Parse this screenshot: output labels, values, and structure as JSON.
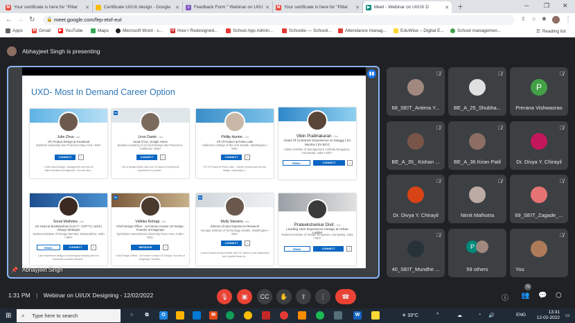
{
  "browser": {
    "tabs": [
      {
        "label": "Your certificate is here for \"Pillar",
        "color": "#ea4335",
        "icon": "gmail-icon",
        "glyph": "M"
      },
      {
        "label": "Certificate UI/UX design - Google",
        "color": "#fbbc04",
        "icon": "slides-icon",
        "glyph": ""
      },
      {
        "label": "Feedback Form \" Webinar on UI/U",
        "color": "#7e57c2",
        "icon": "forms-icon",
        "glyph": "≡"
      },
      {
        "label": "Your certificate is here for \"Pillar",
        "color": "#ea4335",
        "icon": "gmail-icon",
        "glyph": "M"
      },
      {
        "label": "Meet - Webinar on UI/UX D",
        "color": "#00897b",
        "icon": "meet-icon",
        "glyph": "▶"
      }
    ],
    "url": "meet.google.com/fep-etxf-eut",
    "bookmarks": [
      {
        "label": "Apps",
        "color": "#5f6368",
        "icon": "apps-icon"
      },
      {
        "label": "Gmail",
        "color": "#ea4335",
        "icon": "gmail-icon"
      },
      {
        "label": "YouTube",
        "color": "#ff0000",
        "icon": "youtube-icon"
      },
      {
        "label": "Maps",
        "color": "#34a853",
        "icon": "maps-icon"
      },
      {
        "label": "Microsoft Word - c...",
        "color": "#202124",
        "icon": "github-icon"
      },
      {
        "label": "How I Redesigned...",
        "color": "#d32f2f",
        "icon": "ux-icon"
      },
      {
        "label": "School App Admin...",
        "color": "#e53935",
        "icon": "school-icon"
      },
      {
        "label": "Schoolie — Schooli...",
        "color": "#e53935",
        "icon": "schoolie-icon"
      },
      {
        "label": "Attendance manag...",
        "color": "#e53935",
        "icon": "attendance-icon"
      },
      {
        "label": "EduWise – Digital E...",
        "color": "#fdd835",
        "icon": "eduwise-icon"
      },
      {
        "label": "School managemen...",
        "color": "#43a047",
        "icon": "school-management-icon"
      }
    ],
    "reading_list": "Reading list"
  },
  "meet": {
    "presenter_text": "Abhayjeet Singh is presenting",
    "stage_label": "Abhayjeet Singh",
    "slide": {
      "title": "UXD- Most In Demand Career Option",
      "cards": [
        {
          "name": "Julie Zhuo",
          "degree": "• 3rd",
          "title": "VP, Product Design at Facebook",
          "sub": "Stanford University\nSan Francisco Bay Area • 500+",
          "btn": "CONNECT",
          "btn2": "",
          "desc": "I write about design, management and tech at https://medium.com/@joulee. You can also..."
        },
        {
          "name": "Liron Damir",
          "degree": "• 3rd",
          "title": "Head of UX, Google Home",
          "sub": "Bezalel Academy of Art and Design\nSan Francisco, California • 500+",
          "btn": "CONNECT",
          "btn2": "",
          "desc": "I am a design leader with over 12 years of experience experience in product..."
        },
        {
          "name": "Phillip Hunter",
          "degree": "• 3rd",
          "title": "VP of Product at Pulse Labs",
          "sub": "California College of the Arts\nSeattle, Washington • 500+",
          "btn": "CONNECT",
          "btn2": "",
          "desc": "VP of Product at Pulse Labs - I deliver product and service design, especially fo..."
        },
        {
          "name": "Vibin Prabhakaran",
          "degree": "• 2nd",
          "title": "Head Of Customer Experience at Swiggy | Ex Myntra | Ex BCG",
          "sub": "Indian Institute of Management, Kolkata\nBengaluru, Karnataka, India • 500+",
          "btn": "CONNECT",
          "btn2": "EMAIL",
          "desc": ""
        },
        {
          "name": "Sonal Malhotra",
          "degree": "• 2nd",
          "title": "UX Head at BookMyShow (CUA™, CXP™) | Ux/UI | Design Strategist",
          "sub": "National Institute of Design\nMumbai, Maharashtra, India • 500+",
          "btn": "CONNECT",
          "btn2": "EMAIL",
          "desc": "User experience design is a thoroughly enduring field for innovative products towards..."
        },
        {
          "name": "Vidhika Rohagi",
          "degree": "• 3rd",
          "title": "Chief Design Officer - at Fortune Creator UX Design: Founder at Imaginays",
          "sub": "Symbiosis International University\nPune Area, India • 500+",
          "btn": "MESSAGE",
          "btn2": "",
          "desc": "Chief Design Officer - at Fortune Creator UX Design: Founder at Imaginays, Vishaka..."
        },
        {
          "name": "Molly Stevens",
          "degree": "• 3rd",
          "title": "Director of User Experience Research",
          "sub": "Georgia Institute of Technology\nSeattle, Washington • 500+",
          "btn": "CONNECT",
          "btn2": "",
          "desc": "I move forward product leader with 10+ years in user experience and a global focus on..."
        },
        {
          "name": "Prateekshankar Dixit",
          "degree": "• 2nd",
          "title": "Leading User Experience Design at Urban Ladder",
          "sub": "National Institute of Design\nBengaluru, Karnataka, India • 500+",
          "btn": "CONNECT",
          "btn2": "EMAIL",
          "desc": ""
        }
      ]
    },
    "participants": [
      {
        "name": "68_SEIT_Antima Y...",
        "avatar": "photo",
        "color": "#a1887f"
      },
      {
        "name": "BE_A_25_Shubha...",
        "avatar": "photo",
        "color": "#e0e0e0"
      },
      {
        "name": "Prerana Vishwasrao",
        "avatar": "P",
        "color": "#43a047"
      },
      {
        "name": "BE_A_35_ Kishan ...",
        "avatar": "photo",
        "color": "#795548"
      },
      {
        "name": "BE_A_36 Kiran Patil",
        "avatar": "photo",
        "color": "#8d6e63"
      },
      {
        "name": "Dr. Divya Y. Chirayil",
        "avatar": "photo",
        "color": "#c2185b"
      },
      {
        "name": "Dr. Divya Y. Chirayil",
        "avatar": "photo",
        "color": "#d84315"
      },
      {
        "name": "Nimit Malhotra",
        "avatar": "photo",
        "color": "#bcaaa4"
      },
      {
        "name": "69_SEIT_Zagade_...",
        "avatar": "photo",
        "color": "#e57373"
      },
      {
        "name": "40_SEIT_Mundhe ...",
        "avatar": "photo",
        "color": "#263238"
      },
      {
        "name": "59 others",
        "avatar": "P",
        "color": "#00897b"
      },
      {
        "name": "You",
        "avatar": "photo",
        "color": "#ad7a5a"
      }
    ],
    "controls": {
      "time": "1:31 PM",
      "separator": "|",
      "meeting_name": "Webinar on UI/UX Designing - 12/02/2022",
      "participant_count": "71"
    }
  },
  "taskbar": {
    "search_placeholder": "Type here to search",
    "weather": "33°C",
    "lang": "ENG",
    "time": "13:31",
    "date": "12-02-2022"
  }
}
